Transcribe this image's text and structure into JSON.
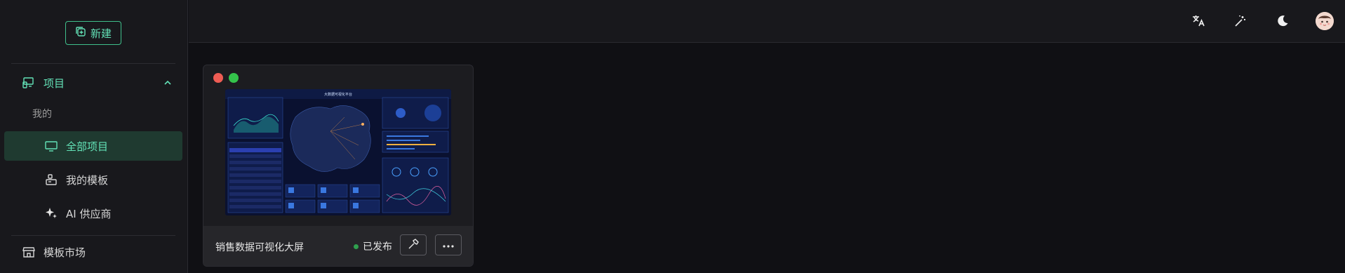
{
  "sidebar": {
    "new_label": "新建",
    "project_group": "项目",
    "sub_label": "我的",
    "items": [
      {
        "label": "全部项目",
        "icon": "monitor-icon",
        "active": true
      },
      {
        "label": "我的模板",
        "icon": "template-icon",
        "active": false
      },
      {
        "label": "AI 供应商",
        "icon": "sparkle-icon",
        "active": false
      }
    ],
    "market_label": "模板市场"
  },
  "topbar": {
    "icons": [
      "translate-icon",
      "magic-wand-icon",
      "moon-icon",
      "avatar"
    ]
  },
  "project_card": {
    "title": "销售数据可视化大屏",
    "status": "已发布",
    "preview_title": "大数据可视化平台",
    "accent_colors": {
      "close": "#ee5c54",
      "maximize": "#34c24b",
      "status": "#2fa04e"
    }
  },
  "colors": {
    "accent": "#63e2b7",
    "background": "#101014",
    "sidebar": "#18181c"
  }
}
